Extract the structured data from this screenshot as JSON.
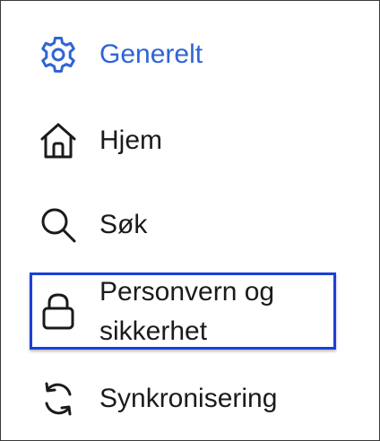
{
  "sidebar": {
    "items": [
      {
        "label": "Generelt",
        "icon": "gear-icon",
        "active": true
      },
      {
        "label": "Hjem",
        "icon": "home-icon",
        "active": false
      },
      {
        "label": "Søk",
        "icon": "search-icon",
        "active": false
      },
      {
        "label_line1": "Personvern og",
        "label_line2": "sikkerhet",
        "icon": "lock-icon",
        "active": false,
        "focused": true
      },
      {
        "label": "Synkronisering",
        "icon": "sync-icon",
        "active": false
      }
    ]
  },
  "colors": {
    "active": "#2f64d6",
    "text": "#1b1b1b",
    "focus_ring": "#1d3fd6",
    "border": "#3a3a3a",
    "background": "#ffffff"
  }
}
